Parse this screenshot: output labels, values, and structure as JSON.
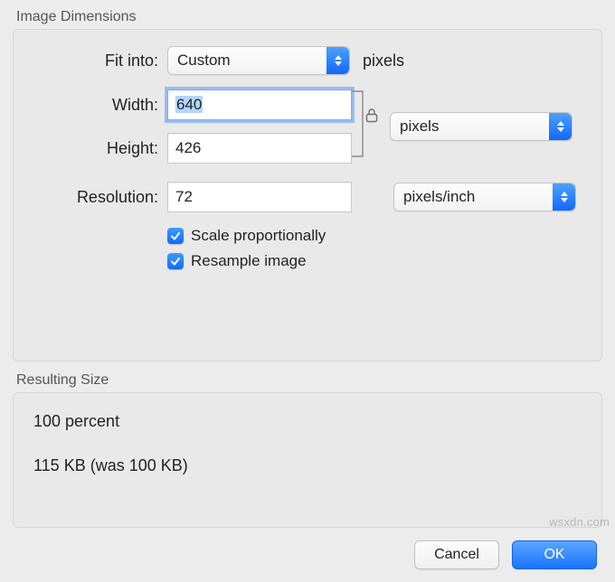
{
  "sections": {
    "dimensions_title": "Image Dimensions",
    "result_title": "Resulting Size"
  },
  "labels": {
    "fit_into": "Fit into:",
    "width": "Width:",
    "height": "Height:",
    "resolution": "Resolution:"
  },
  "fit": {
    "selected": "Custom",
    "unit": "pixels"
  },
  "width": {
    "value": "640"
  },
  "height": {
    "value": "426"
  },
  "size_unit": {
    "selected": "pixels"
  },
  "resolution": {
    "value": "72"
  },
  "resolution_unit": {
    "selected": "pixels/inch"
  },
  "checks": {
    "scale": "Scale proportionally",
    "resample": "Resample image"
  },
  "result": {
    "line1": "100 percent",
    "line2": "115 KB (was 100 KB)"
  },
  "buttons": {
    "cancel": "Cancel",
    "ok": "OK"
  },
  "watermark": "wsxdn.com"
}
